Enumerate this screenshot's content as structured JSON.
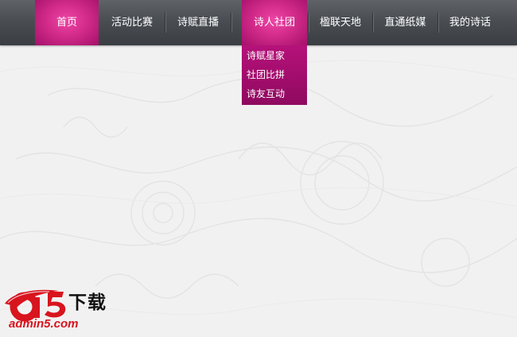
{
  "nav": {
    "items": [
      {
        "label": "首页",
        "active": true
      },
      {
        "label": "活动比赛",
        "active": false
      },
      {
        "label": "诗赋直播",
        "active": false
      },
      {
        "label": "诗人社团",
        "active": true
      },
      {
        "label": "楹联天地",
        "active": false
      },
      {
        "label": "直通纸媒",
        "active": false
      },
      {
        "label": "我的诗话",
        "active": false
      }
    ],
    "active_color": "#d32b8a",
    "bar_color": "#4a4e53"
  },
  "dropdown": {
    "items": [
      {
        "label": "诗赋星家"
      },
      {
        "label": "社团比拼"
      },
      {
        "label": "诗友互动"
      }
    ],
    "color": "#a30d6d"
  },
  "logo": {
    "top_text": "下载",
    "bottom_text": "admin5.com",
    "brand_color": "#d8141e"
  }
}
